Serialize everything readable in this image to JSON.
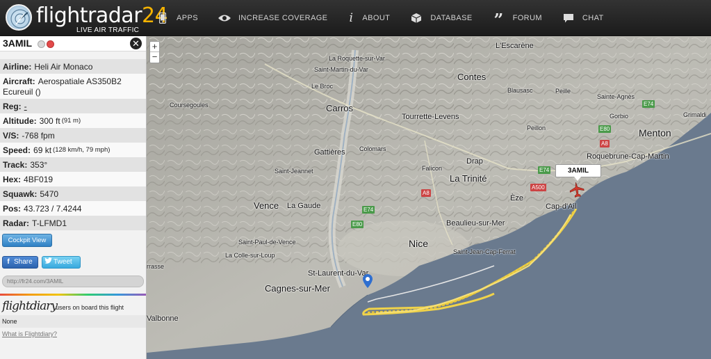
{
  "header": {
    "logo": {
      "word": "flightradar",
      "number": "24",
      "tagline": "LIVE AIR TRAFFIC"
    },
    "nav": [
      {
        "label": "APPS",
        "icon": "phone-icon"
      },
      {
        "label": "INCREASE COVERAGE",
        "icon": "eye-icon"
      },
      {
        "label": "ABOUT",
        "icon": "info-icon"
      },
      {
        "label": "DATABASE",
        "icon": "box-icon"
      },
      {
        "label": "FORUM",
        "icon": "quote-icon"
      },
      {
        "label": "CHAT",
        "icon": "speech-bubble-icon"
      }
    ]
  },
  "panel": {
    "callsign": "3AMIL",
    "close": "✕",
    "fields": {
      "airline": {
        "label": "Airline:",
        "value": "Heli Air Monaco"
      },
      "aircraft": {
        "label": "Aircraft:",
        "value": "Aerospatiale AS350B2 Ecureuil ()"
      },
      "reg": {
        "label": "Reg:",
        "value": "-"
      },
      "altitude": {
        "label": "Altitude:",
        "value": "300 ft",
        "extra": "(91 m)"
      },
      "vs": {
        "label": "V/S:",
        "value": "-768 fpm"
      },
      "speed": {
        "label": "Speed:",
        "value": "69 kt",
        "extra": "(128 km/h, 79 mph)"
      },
      "track": {
        "label": "Track:",
        "value": "353°"
      },
      "hex": {
        "label": "Hex:",
        "value": "4BF019"
      },
      "squawk": {
        "label": "Squawk:",
        "value": "5470"
      },
      "pos": {
        "label": "Pos:",
        "value": "43.723 / 7.4244"
      },
      "radar": {
        "label": "Radar:",
        "value": "T-LFMD1"
      }
    },
    "cockpit_button": "Cockpit View",
    "share_button": "Share",
    "tweet_button": "Tweet",
    "share_url": "http://fr24.com/3AMIL",
    "flightdiary": {
      "logo": "flightdiary",
      "text": "users on board this flight",
      "none": "None",
      "link": "What is Flightdiary?"
    }
  },
  "map": {
    "zoom_in": "+",
    "zoom_out": "−",
    "plane_label": "3AMIL",
    "places": [
      "L'Escarène",
      "La Roquette-sur-Var",
      "Saint-Martin-du-Var",
      "Contes",
      "Le Broc",
      "Blausasc",
      "Peille",
      "Sainte-Agnès",
      "Coursegoules",
      "Carros",
      "Tourrette-Levens",
      "Gorbio",
      "Grimaldi",
      "Menton",
      "Peillon",
      "Roquebrune-Cap-Martin",
      "Gattières",
      "Colomars",
      "Drap",
      "Falicon",
      "Saint-Jeannet",
      "La Trinité",
      "Èze",
      "Cap-d'Ail",
      "Vence",
      "La Gaude",
      "Beaulieu-sur-Mer",
      "Nice",
      "Saint-Paul-de-Vence",
      "Saint-Jean-Cap-Ferrat",
      "La Colle-sur-Loup",
      "rrasse",
      "St-Laurent-du-Var",
      "Cagnes-sur-Mer",
      "Valbonne"
    ],
    "roads": [
      "E74",
      "E80",
      "A8",
      "E74",
      "A8",
      "A500",
      "E74",
      "E80"
    ]
  }
}
